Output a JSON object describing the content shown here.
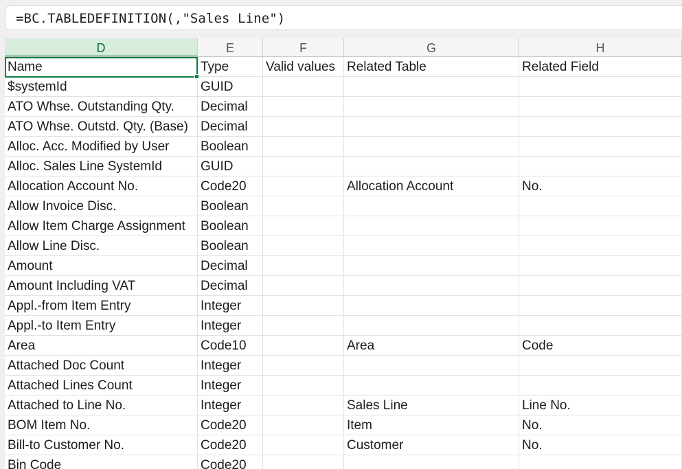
{
  "formula_bar": {
    "text": "=BC.TABLEDEFINITION(,\"Sales Line\")"
  },
  "columns": [
    "D",
    "E",
    "F",
    "G",
    "H"
  ],
  "selected_column": "D",
  "rows": [
    [
      "Name",
      "Type",
      "Valid values",
      "Related Table",
      "Related Field"
    ],
    [
      "$systemId",
      "GUID",
      "",
      "",
      ""
    ],
    [
      "ATO Whse. Outstanding Qty.",
      "Decimal",
      "",
      "",
      ""
    ],
    [
      "ATO Whse. Outstd. Qty. (Base)",
      "Decimal",
      "",
      "",
      ""
    ],
    [
      "Alloc. Acc. Modified by User",
      "Boolean",
      "",
      "",
      ""
    ],
    [
      "Alloc. Sales Line SystemId",
      "GUID",
      "",
      "",
      ""
    ],
    [
      "Allocation Account No.",
      "Code20",
      "",
      "Allocation Account",
      "No."
    ],
    [
      "Allow Invoice Disc.",
      "Boolean",
      "",
      "",
      ""
    ],
    [
      "Allow Item Charge Assignment",
      "Boolean",
      "",
      "",
      ""
    ],
    [
      "Allow Line Disc.",
      "Boolean",
      "",
      "",
      ""
    ],
    [
      "Amount",
      "Decimal",
      "",
      "",
      ""
    ],
    [
      "Amount Including VAT",
      "Decimal",
      "",
      "",
      ""
    ],
    [
      "Appl.-from Item Entry",
      "Integer",
      "",
      "",
      ""
    ],
    [
      "Appl.-to Item Entry",
      "Integer",
      "",
      "",
      ""
    ],
    [
      "Area",
      "Code10",
      "",
      "Area",
      "Code"
    ],
    [
      "Attached Doc Count",
      "Integer",
      "",
      "",
      ""
    ],
    [
      "Attached Lines Count",
      "Integer",
      "",
      "",
      ""
    ],
    [
      "Attached to Line No.",
      "Integer",
      "",
      "Sales Line",
      "Line No."
    ],
    [
      "BOM Item No.",
      "Code20",
      "",
      "Item",
      "No."
    ],
    [
      "Bill-to Customer No.",
      "Code20",
      "",
      "Customer",
      "No."
    ],
    [
      "Bin Code",
      "Code20",
      "",
      "",
      ""
    ]
  ],
  "colors": {
    "accent": "#107c41",
    "selected_header_bg": "#d7ecdd",
    "grid_line": "#e1e1e1"
  }
}
